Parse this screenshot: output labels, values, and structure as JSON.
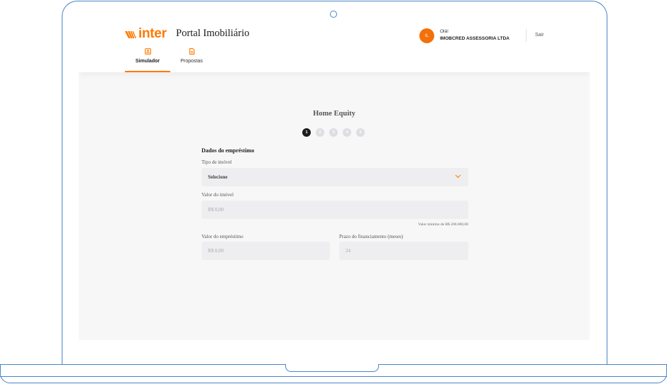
{
  "app": {
    "logo_text": "inter",
    "title": "Portal Imobiliário"
  },
  "user": {
    "initials": "IL",
    "greeting": "Olá!",
    "company": "IMOBCRED ASSESSORIA LTDA",
    "logout_label": "Sair"
  },
  "tabs": [
    {
      "label": "Simulador",
      "icon": "simulator-icon",
      "active": true
    },
    {
      "label": "Propostas",
      "icon": "document-icon",
      "active": false
    }
  ],
  "form": {
    "title": "Home Equity",
    "steps": [
      "1",
      "2",
      "3",
      "4",
      "5"
    ],
    "current_step": 1,
    "section_title": "Dados do empréstimo",
    "property_type": {
      "label": "Tipo de imóvel",
      "value": "Selecione"
    },
    "property_value": {
      "label": "Valor do imóvel",
      "placeholder": "R$ 0,00",
      "hint": "Valor mínimo de R$ 200.000,00"
    },
    "loan_value": {
      "label": "Valor do empréstimo",
      "placeholder": "R$ 0,00"
    },
    "term": {
      "label": "Prazo do financiamento (meses)",
      "placeholder": "24"
    }
  },
  "colors": {
    "brand": "#ff7a00",
    "frame": "#4a86c5",
    "field_bg": "#eeeef0",
    "step_active": "#1c1c1c",
    "step_inactive": "#dedee2"
  }
}
